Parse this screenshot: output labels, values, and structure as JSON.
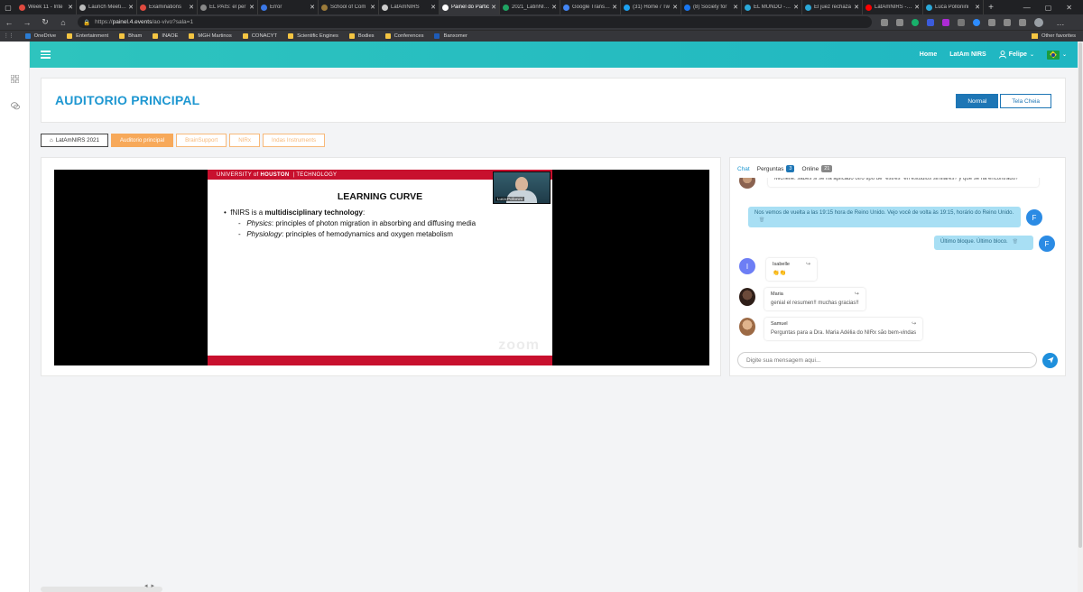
{
  "browser": {
    "tabs": [
      {
        "title": "Week 11 - Inte",
        "color": "#e04a3f"
      },
      {
        "title": "Launch Meeting",
        "color": "#bbbbbb"
      },
      {
        "title": "Examinations",
        "color": "#e04a3f"
      },
      {
        "title": "EL PAÍS: el per",
        "color": "#888888"
      },
      {
        "title": "Error",
        "color": "#3b78e7"
      },
      {
        "title": "School of Com",
        "color": "#9c7b3a"
      },
      {
        "title": "LatAmNIRS",
        "color": "#cccccc"
      },
      {
        "title": "Painel do Partic",
        "color": "#ffffff",
        "active": true
      },
      {
        "title": "2021_LatinNIRS",
        "color": "#1fa463"
      },
      {
        "title": "Google Translat",
        "color": "#4285f4"
      },
      {
        "title": "(31) Home / Tw",
        "color": "#1da1f2"
      },
      {
        "title": "(8) Society for",
        "color": "#1877f2"
      },
      {
        "title": "EL MUNDO - Di",
        "color": "#2aa8d8"
      },
      {
        "title": "El juez rechaza",
        "color": "#2aa8d8"
      },
      {
        "title": "LatAmNIRS - Yo",
        "color": "#ff0000"
      },
      {
        "title": "Luca Pollonini",
        "color": "#2aa8d8"
      }
    ],
    "url_prefix": "https://",
    "url_host": "painel.4.events",
    "url_path": "/ao-vivo?sala=1",
    "bookmarks": [
      {
        "label": "OneDrive",
        "color": "#2b7cd3"
      },
      {
        "label": "Entertainment",
        "color": "#f4c542"
      },
      {
        "label": "Bham",
        "color": "#f4c542"
      },
      {
        "label": "INAOE",
        "color": "#f4c542"
      },
      {
        "label": "MGH Martinos",
        "color": "#f4c542"
      },
      {
        "label": "CONACYT",
        "color": "#f4c542"
      },
      {
        "label": "Scientific Engines",
        "color": "#f4c542"
      },
      {
        "label": "Bodies",
        "color": "#f4c542"
      },
      {
        "label": "Conferences",
        "color": "#f4c542"
      },
      {
        "label": "Banxomer",
        "color": "#1e5bb8"
      }
    ],
    "other_favorites": "Other favorites",
    "window_controls": [
      "—",
      "▢",
      "✕"
    ]
  },
  "topnav": {
    "home": "Home",
    "latam": "LatAm NIRS",
    "user": "Felipe"
  },
  "header": {
    "title": "AUDITORIO PRINCIPAL",
    "mode_normal": "Normal",
    "mode_full": "Tela Cheia"
  },
  "rooms": [
    {
      "label": "LatAmNIRS 2021",
      "home": true
    },
    {
      "label": "Auditorio principal",
      "active": true
    },
    {
      "label": "BrainSupport"
    },
    {
      "label": "NIRx"
    },
    {
      "label": "Indas Instruments"
    }
  ],
  "slide": {
    "top_banner_pre": "UNIVERSITY of",
    "top_banner_bold": "HOUSTON",
    "top_banner_post": "TECHNOLOGY",
    "title": "LEARNING CURVE",
    "bullet_pre": "fNIRS is a ",
    "bullet_bold": "multidisciplinary technology",
    "bullet_post": ":",
    "sub1_label": "Physics",
    "sub1_text": ": principles of photon migration in absorbing and diffusing media",
    "sub2_label": "Physiology",
    "sub2_text": ": principles of hemodynamics and oxygen metabolism",
    "watermark": "zoom",
    "speaker_name": "Luca Pollonini"
  },
  "chat": {
    "tabs": {
      "chat": "Chat",
      "questions": "Perguntas",
      "questions_count": "3",
      "online": "Online",
      "online_count": "21"
    },
    "messages": [
      {
        "text": "Michelle: sabes si se ha aplicado otro tipo de \"estrés\" en estudios similares? y que se ha encontrado?"
      },
      {
        "text": "Nos vemos de vuelta a las 19:15 hora de Reino Unido. Vejo você de volta às 19:15, horário do Reino Unido.",
        "avatar": "F"
      },
      {
        "text": "Último bloque. Último bloco.",
        "avatar": "F"
      },
      {
        "author": "Isabelle",
        "text": "👏👏",
        "avatar": "I"
      },
      {
        "author": "Maria",
        "text": "genial el resumen!! muchas gracias!!"
      },
      {
        "author": "Samuel",
        "text": "Perguntas para a Dra. Maria Adélia do NIRx são bem-vindas"
      }
    ],
    "input_placeholder": "Digite sua mensagem aqui..."
  }
}
